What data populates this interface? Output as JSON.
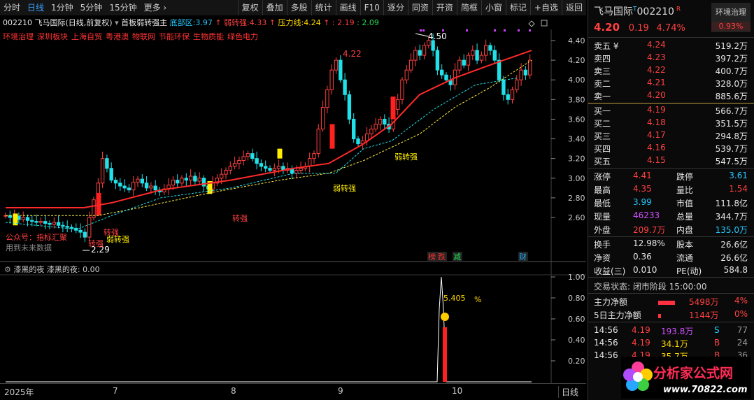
{
  "toolbar": {
    "items": [
      "分时",
      "日线",
      "1分钟",
      "5分钟",
      "15分钟",
      "更多 ›"
    ],
    "active_index": 1,
    "right_items": [
      "复权",
      "叠加",
      "多股",
      "统计",
      "画线",
      "F10",
      "逐分",
      "同资",
      "开资",
      "简框",
      "小窗",
      "标记",
      "+自选",
      "返回"
    ]
  },
  "info": {
    "code_name": "002210 飞马国际(日线,前复权)",
    "indicator": "首板弱转强主",
    "bottom_label": "底部区:",
    "bottom_value": "3.97",
    "weak_label": "弱转强:",
    "weak_value": "4.33",
    "pressure_label": "压力线:",
    "pressure_value": "4.24",
    "val_a": ": 2.19",
    "val_b": ": 2.09"
  },
  "boards": [
    "环境治理",
    "深圳板块",
    "上海自贸",
    "粤港澳",
    "物联网",
    "节能环保",
    "生物质能",
    "绿色电力"
  ],
  "price_axis": [
    "4.40",
    "4.20",
    "4.00",
    "3.80",
    "3.60",
    "3.40",
    "3.20",
    "3.00",
    "2.80",
    "2.60"
  ],
  "sub_axis": [
    "1.00",
    "0.80",
    "0.60",
    "0.40",
    "0.20"
  ],
  "annotations": {
    "high_422": "4.22",
    "high_450": "4.50",
    "low_229": "2.29",
    "zhuanqiang": "转强",
    "ruozhuanqiang": "弱转强",
    "gongzhonghao": "公众号：指标汇聚",
    "future_data": "用到未来数据",
    "pct_value": "5.405",
    "pct_unit": "%",
    "tag_bang": "榜",
    "tag_die": "跌",
    "tag_jian": "减",
    "tag_cai": "财"
  },
  "sub_chart": {
    "title": "漆黑的夜",
    "value_text": "漆黑的夜: 0.00"
  },
  "date_axis": {
    "labels": [
      "2025年",
      "7",
      "8",
      "9",
      "10"
    ],
    "period": "日线"
  },
  "quote": {
    "name": "飞马国际",
    "code": "002210",
    "sector": "环境治理",
    "sector_pct": "0.93%",
    "price": "4.20",
    "change": "0.19",
    "change_pct": "4.74%",
    "asks": [
      {
        "label": "卖五 ¥",
        "price": "4.24",
        "vol": "519.2万"
      },
      {
        "label": "卖四",
        "price": "4.23",
        "vol": "397.2万"
      },
      {
        "label": "卖三",
        "price": "4.22",
        "vol": "400.7万"
      },
      {
        "label": "卖二",
        "price": "4.21",
        "vol": "328.0万"
      },
      {
        "label": "卖一",
        "price": "4.20",
        "vol": "885.6万"
      }
    ],
    "bids": [
      {
        "label": "买一",
        "price": "4.19",
        "vol": "566.7万"
      },
      {
        "label": "买二",
        "price": "4.18",
        "vol": "351.5万"
      },
      {
        "label": "买三",
        "price": "4.17",
        "vol": "294.8万"
      },
      {
        "label": "买四",
        "price": "4.16",
        "vol": "539.7万"
      },
      {
        "label": "买五",
        "price": "4.15",
        "vol": "547.5万"
      }
    ],
    "stats": [
      {
        "k1": "涨停",
        "v1": "4.41",
        "c1": "red",
        "k2": "跌停",
        "v2": "3.61",
        "c2": "cyan"
      },
      {
        "k1": "最高",
        "v1": "4.35",
        "c1": "red",
        "k2": "量比",
        "v2": "1.54",
        "c2": "red"
      },
      {
        "k1": "最低",
        "v1": "3.99",
        "c1": "cyan",
        "k2": "市值",
        "v2": "111.8亿",
        "c2": "white"
      },
      {
        "k1": "现量",
        "v1": "46233",
        "c1": "purple",
        "k2": "总量",
        "v2": "344.7万",
        "c2": "white"
      },
      {
        "k1": "外盘",
        "v1": "209.7万",
        "c1": "red",
        "k2": "内盘",
        "v2": "135.0万",
        "c2": "cyan"
      }
    ],
    "stats2": [
      {
        "k1": "换手",
        "v1": "12.98%",
        "k2": "股本",
        "v2": "26.6亿"
      },
      {
        "k1": "净资",
        "v1": "0.36",
        "k2": "流通",
        "v2": "26.6亿"
      },
      {
        "k1": "收益(三)",
        "v1": "0.010",
        "k2": "PE(动)",
        "v2": "584.8"
      }
    ],
    "trade_status": "交易状态: 闭市阶段 15:00:00",
    "flows": [
      {
        "label": "主力净额",
        "value": "5498万",
        "pct": "4%"
      },
      {
        "label": "5日主力净额",
        "value": "1144万",
        "pct": "0%"
      }
    ],
    "ticks": [
      {
        "time": "14:56",
        "price": "4.19",
        "vol": "193.8万",
        "side": "S",
        "n": "77"
      },
      {
        "time": "14:56",
        "price": "4.19",
        "vol": "34.1万",
        "side": "B",
        "n": "24"
      },
      {
        "time": "14:56",
        "price": "4.19",
        "vol": "35.7万",
        "side": "B",
        "n": "36"
      }
    ]
  },
  "logo": {
    "name": "分析家公式网",
    "url": "www.70822.com"
  }
}
